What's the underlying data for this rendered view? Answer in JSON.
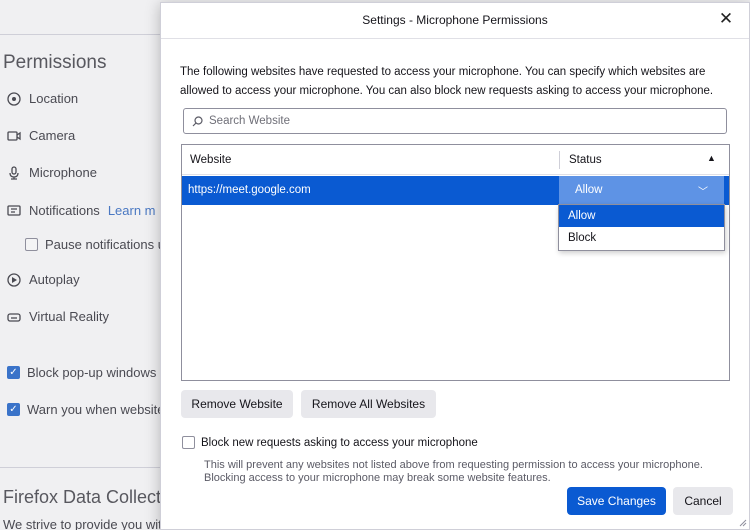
{
  "background": {
    "section_title": "Permissions",
    "permissions": [
      {
        "label": "Location",
        "icon": "location-icon"
      },
      {
        "label": "Camera",
        "icon": "camera-icon"
      },
      {
        "label": "Microphone",
        "icon": "microphone-icon"
      },
      {
        "label": "Notifications",
        "icon": "notifications-icon",
        "link": "Learn m"
      },
      {
        "label": "Autoplay",
        "icon": "autoplay-icon"
      },
      {
        "label": "Virtual Reality",
        "icon": "virtual-reality-icon"
      }
    ],
    "pause_notifications": "Pause notifications u",
    "block_popups": "Block pop-up windows",
    "warn_websites": "Warn you when websites",
    "data_collection_title": "Firefox Data Collecti",
    "data_collection_text": "We strive to provide you wit"
  },
  "dialog": {
    "title": "Settings - Microphone Permissions",
    "description": "The following websites have requested to access your microphone. You can specify which websites are allowed to access your microphone. You can also block new requests asking to access your microphone.",
    "search_placeholder": "Search Website",
    "table": {
      "col_website": "Website",
      "col_status": "Status",
      "rows": [
        {
          "website": "https://meet.google.com",
          "status": "Allow"
        }
      ]
    },
    "status_options": [
      "Allow",
      "Block"
    ],
    "selected_option": "Allow",
    "remove_website": "Remove Website",
    "remove_all": "Remove All Websites",
    "block_checkbox_label": "Block new requests asking to access your microphone",
    "block_checked": false,
    "note": "This will prevent any websites not listed above from requesting permission to access your microphone. Blocking access to your microphone may break some website features.",
    "save": "Save Changes",
    "cancel": "Cancel"
  },
  "colors": {
    "accent": "#0a5ad2",
    "status_bg": "#5e93e5",
    "checkbox_blue": "#3a73c9"
  }
}
